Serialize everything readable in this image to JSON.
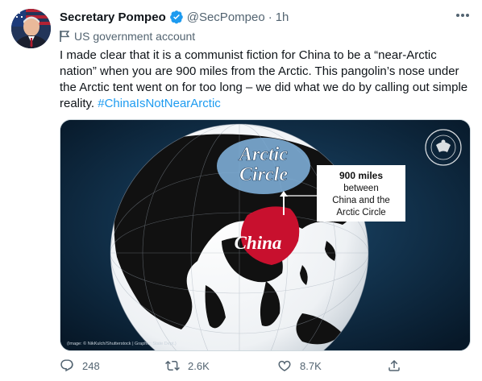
{
  "tweet": {
    "display_name": "Secretary Pompeo",
    "handle": "@SecPompeo",
    "separator": "·",
    "time": "1h",
    "gov_label": "US government account",
    "text": "I made clear that it is a communist fiction for China to be a “near-Arctic nation” when you are 900 miles from the Arctic. This pangolin’s nose under the Arctic tent went on for too long – we did what we do by calling out simple reality.",
    "hashtag": "#ChinaIsNotNearArctic"
  },
  "media": {
    "arctic_label_line1": "Arctic",
    "arctic_label_line2": "Circle",
    "china_label": "China",
    "callout_line1": "900 miles",
    "callout_line2": "between",
    "callout_line3": "China and the",
    "callout_line4": "Arctic Circle",
    "credit": "(Image: © NikKulch/Shutterstock | Graphic: State Dept.)",
    "seal_text": "DEPARTMENT OF STATE · UNITED STATES OF AMERICA"
  },
  "actions": {
    "reply_count": "248",
    "retweet_count": "2.6K",
    "like_count": "8.7K"
  },
  "icons": {
    "verified": "verified-badge-icon",
    "more": "more-options-icon",
    "flag": "flag-icon",
    "reply": "reply-icon",
    "retweet": "retweet-icon",
    "like": "heart-icon",
    "share": "share-icon"
  },
  "colors": {
    "accent": "#1d9bf0",
    "text": "#0f1419",
    "secondary_text": "#536471",
    "ocean_dark": "#0b2238",
    "china_red": "#c8102e",
    "arctic_blue": "#4a90c8"
  }
}
